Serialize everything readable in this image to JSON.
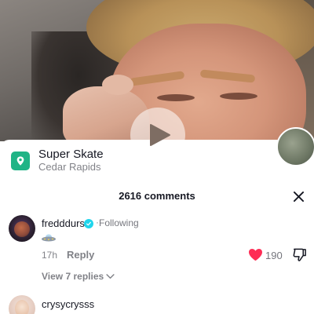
{
  "video": {
    "play_icon": "play-icon",
    "side_avatar_icon": "music-disc-avatar"
  },
  "location": {
    "icon": "location-pin-icon",
    "title": "Super Skate",
    "subtitle": "Cedar Rapids",
    "accent": "#20b486"
  },
  "comments": {
    "count_label": "2616 comments",
    "close_icon": "close-icon",
    "items": [
      {
        "username": "fredddurst",
        "verified": true,
        "separator": "·",
        "follow_status": "Following",
        "content_emoji": "ufo-emoji",
        "time": "17h",
        "reply_label": "Reply",
        "like_count": "190",
        "liked": true,
        "view_replies_label": "View 7 replies",
        "like_color": "#fe2c55"
      },
      {
        "username": "crysycrysss"
      }
    ]
  }
}
